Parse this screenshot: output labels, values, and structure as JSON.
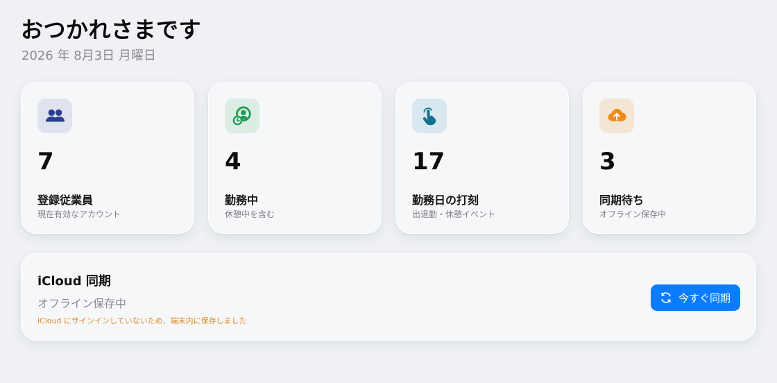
{
  "header": {
    "greeting": "おつかれさまです",
    "date": "2026 年 8月3日 月曜日"
  },
  "stats": [
    {
      "icon": "people-icon",
      "value": "7",
      "label": "登録従業員",
      "sub": "現在有効なアカウント",
      "color": "#2b3f8f",
      "bg": "#dfe3ee"
    },
    {
      "icon": "person-clock-icon",
      "value": "4",
      "label": "勤務中",
      "sub": "休憩中を含む",
      "color": "#1f9a55",
      "bg": "#dceee3"
    },
    {
      "icon": "hand-tap-icon",
      "value": "17",
      "label": "勤務日の打刻",
      "sub": "出退勤・休憩イベント",
      "color": "#16708e",
      "bg": "#d9e8ee"
    },
    {
      "icon": "cloud-upload-icon",
      "value": "3",
      "label": "同期待ち",
      "sub": "オフライン保存中",
      "color": "#ef8a17",
      "bg": "#f4e6d5"
    }
  ],
  "sync": {
    "title": "iCloud 同期",
    "status": "オフライン保存中",
    "note": "iCloud にサインインしていないため、端末内に保存しました",
    "button_label": "今すぐ同期",
    "button_icon": "sync-icon",
    "button_color": "#0a7cff",
    "note_color": "#e08a1e"
  }
}
